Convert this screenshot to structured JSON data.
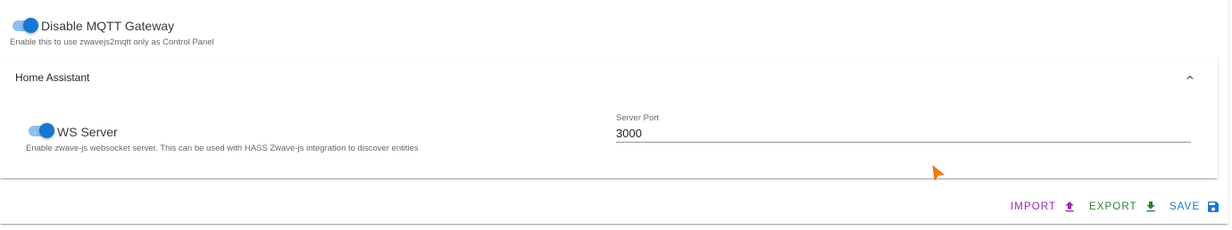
{
  "gateway": {
    "disable_mqtt_label": "Disable MQTT Gateway",
    "disable_mqtt_helper": "Enable this to use zwavejs2mqtt only as Control Panel",
    "disable_mqtt_checked": true
  },
  "home_assistant": {
    "title": "Home Assistant",
    "expanded": true,
    "ws_server_label": "WS Server",
    "ws_server_helper": "Enable zwave-js websocket server. This can be used with HASS Zwave-js integration to discover entities",
    "ws_server_checked": true,
    "server_port_label": "Server Port",
    "server_port_value": "3000"
  },
  "actions": {
    "import_label": "IMPORT",
    "export_label": "EXPORT",
    "save_label": "SAVE"
  },
  "colors": {
    "switch_on": "#1976d2",
    "import": "#9c27b0",
    "export": "#2e7d32",
    "save": "#1976d2",
    "cursor": "#f57c00"
  },
  "icons": {
    "toggle": "switch-on",
    "collapse": "chevron-up-icon",
    "import": "upload-icon",
    "export": "download-icon",
    "save": "floppy-disk-icon",
    "pointer": "mouse-cursor-icon"
  }
}
